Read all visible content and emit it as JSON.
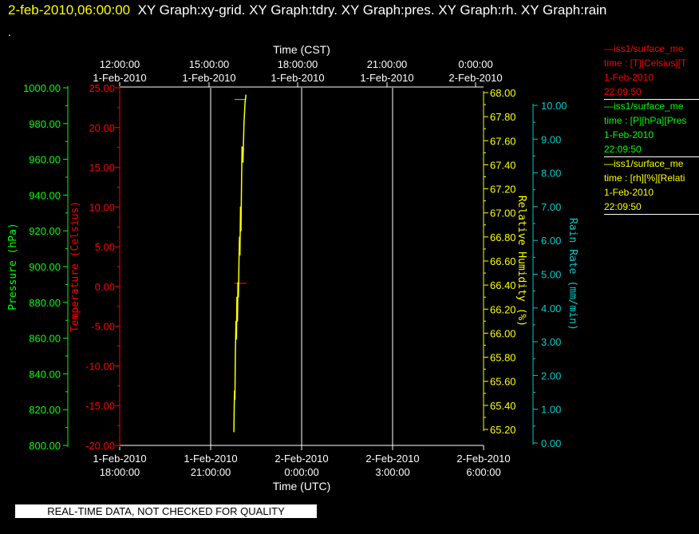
{
  "header": {
    "date": "2-feb-2010,06:00:00",
    "graphs": "XY Graph:xy-grid.  XY Graph:tdry.  XY Graph:pres.  XY Graph:rh.  XY Graph:rain",
    "second_line": "."
  },
  "footer": {
    "warning": "REAL-TIME DATA, NOT CHECKED FOR QUALITY"
  },
  "legend": [
    {
      "name": "—iss1/surface_me",
      "units": "time : [T][Celsius][T",
      "date": "1-Feb-2010",
      "time": "22:09:50",
      "color": "#ff0000"
    },
    {
      "name": "—iss1/surface_me",
      "units": "time : [P][hPa][Pres",
      "date": "1-Feb-2010",
      "time": "22:09:50",
      "color": "#00ff00"
    },
    {
      "name": "—iss1/surface_me",
      "units": "time : [rh][%][Relati",
      "date": "1-Feb-2010",
      "time": "22:09:50",
      "color": "#ffff00"
    }
  ],
  "chart_data": {
    "type": "line",
    "top_axis": {
      "label": "Time (CST)",
      "ticks": [
        {
          "time": "12:00:00",
          "date": "1-Feb-2010"
        },
        {
          "time": "15:00:00",
          "date": "1-Feb-2010"
        },
        {
          "time": "18:00:00",
          "date": "1-Feb-2010"
        },
        {
          "time": "21:00:00",
          "date": "1-Feb-2010"
        },
        {
          "time": "0:00:00",
          "date": "2-Feb-2010"
        }
      ]
    },
    "bottom_axis": {
      "label": "Time (UTC)",
      "range": [
        "2010-02-01 18:00:00",
        "2010-02-02 06:00:00"
      ],
      "ticks": [
        {
          "time": "18:00:00",
          "date": "1-Feb-2010"
        },
        {
          "time": "21:00:00",
          "date": "1-Feb-2010"
        },
        {
          "time": "0:00:00",
          "date": "2-Feb-2010"
        },
        {
          "time": "3:00:00",
          "date": "2-Feb-2010"
        },
        {
          "time": "6:00:00",
          "date": "2-Feb-2010"
        }
      ]
    },
    "y_axes": [
      {
        "id": "pres",
        "label": "Pressure (hPa)",
        "color": "#00ff00",
        "range": [
          800,
          1000
        ],
        "ticks": [
          "800.00",
          "820.00",
          "840.00",
          "860.00",
          "880.00",
          "900.00",
          "920.00",
          "940.00",
          "960.00",
          "980.00",
          "1000.00"
        ]
      },
      {
        "id": "tdry",
        "label": "Temperature (Celsius)",
        "color": "#ff0000",
        "range": [
          -20,
          25
        ],
        "ticks": [
          "-20.00",
          "-15.00",
          "-10.00",
          "-5.00",
          "0.00",
          "5.00",
          "10.00",
          "15.00",
          "20.00",
          "25.00"
        ]
      },
      {
        "id": "rh",
        "label": "Relative Humidity (%)",
        "color": "#ffff00",
        "range": [
          65.1,
          68.0
        ],
        "ticks": [
          "65.20",
          "65.40",
          "65.60",
          "65.80",
          "66.00",
          "66.20",
          "66.40",
          "66.60",
          "66.80",
          "67.00",
          "67.20",
          "67.40",
          "67.60",
          "67.80",
          "68.00"
        ]
      },
      {
        "id": "rain",
        "label": "Rain Rate (mm/min)",
        "color": "#00cccc",
        "range": [
          0,
          10.5
        ],
        "ticks": [
          "0.00",
          "1.00",
          "2.00",
          "3.00",
          "4.00",
          "5.00",
          "6.00",
          "7.00",
          "8.00",
          "9.00",
          "10.00"
        ]
      }
    ],
    "grid": true,
    "series": [
      {
        "name": "Temperature (Celsius)",
        "axis": "tdry",
        "color": "#ff0000",
        "x": [
          "2010-02-01 21:48:00",
          "2010-02-01 22:09:50"
        ],
        "y": [
          0.4,
          0.4
        ]
      },
      {
        "name": "Pressure (hPa)",
        "axis": "pres",
        "color": "#00ff00",
        "x": [
          "2010-02-01 21:48:00",
          "2010-02-01 22:09:50"
        ],
        "y": [
          993.5,
          993.5
        ]
      },
      {
        "name": "Relative Humidity (%)",
        "axis": "rh",
        "color": "#ffff00",
        "x": [
          "2010-02-01 21:46:00",
          "2010-02-01 21:47:00",
          "2010-02-01 21:48:00",
          "2010-02-01 21:49:00",
          "2010-02-01 21:50:00",
          "2010-02-01 21:51:00",
          "2010-02-01 21:52:00",
          "2010-02-01 21:53:00",
          "2010-02-01 21:54:00",
          "2010-02-01 21:55:00",
          "2010-02-01 21:56:00",
          "2010-02-01 21:57:00",
          "2010-02-01 21:58:00",
          "2010-02-01 21:59:00",
          "2010-02-01 22:00:00",
          "2010-02-01 22:01:00",
          "2010-02-01 22:02:00",
          "2010-02-01 22:04:00",
          "2010-02-01 22:06:00",
          "2010-02-01 22:08:00",
          "2010-02-01 22:09:50"
        ],
        "y": [
          65.18,
          65.52,
          65.45,
          65.85,
          66.1,
          65.95,
          66.3,
          66.1,
          66.42,
          66.3,
          66.6,
          66.8,
          66.65,
          67.05,
          66.85,
          67.2,
          67.55,
          67.42,
          67.75,
          67.92,
          67.98
        ]
      }
    ]
  }
}
